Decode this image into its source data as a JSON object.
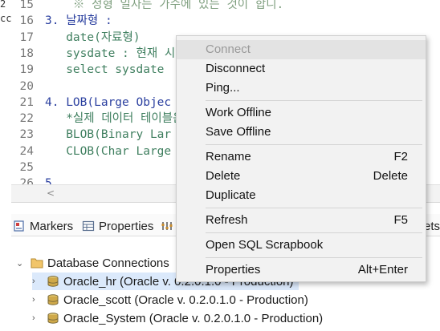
{
  "editor": {
    "edge_fragments": [
      "2",
      "cc"
    ],
    "lines": [
      {
        "num": "15",
        "text": "    ※ 정형 일자는 가수에 있는 것이 합니.",
        "style": "top"
      },
      {
        "num": "16",
        "text": "3. 날짜형 :",
        "style": "blue"
      },
      {
        "num": "17",
        "text": "   date(자료형)",
        "style": "normal"
      },
      {
        "num": "18",
        "text": "   sysdate : 현재 시",
        "style": "normal"
      },
      {
        "num": "19",
        "text": "   select sysdate",
        "style": "normal"
      },
      {
        "num": "20",
        "text": "",
        "style": "normal"
      },
      {
        "num": "21",
        "text": "4. LOB(Large Objec",
        "style": "blue"
      },
      {
        "num": "22",
        "text": "   *실제 데이터 테이블은",
        "style": "normal"
      },
      {
        "num": "23",
        "text": "   BLOB(Binary Lar",
        "style": "normal"
      },
      {
        "num": "24",
        "text": "   CLOB(Char Large",
        "style": "normal"
      },
      {
        "num": "25",
        "text": "",
        "style": "normal"
      },
      {
        "num": "26",
        "text": "5.              ",
        "style": "blue"
      }
    ],
    "scroll_arrow": "<"
  },
  "panel": {
    "tabs": [
      {
        "label": "Markers",
        "icon": "markers-icon"
      },
      {
        "label": "Properties",
        "icon": "properties-icon"
      },
      {
        "label": "",
        "icon": "servers-icon"
      },
      {
        "label": "ets",
        "icon": ""
      }
    ],
    "tree": {
      "root": {
        "label": "Database Connections",
        "icon": "folder-icon",
        "twisty": "⌄"
      },
      "children": [
        {
          "label": "Oracle_hr (Oracle v. 0.2.0.1.0 - Production)",
          "icon": "database-icon",
          "twisty": "›"
        },
        {
          "label": "Oracle_scott (Oracle v. 0.2.0.1.0 - Production)",
          "icon": "database-icon",
          "twisty": "›"
        },
        {
          "label": "Oracle_System (Oracle v. 0.2.0.1.0 - Production)",
          "icon": "database-icon",
          "twisty": "›"
        }
      ]
    }
  },
  "context_menu": {
    "items": [
      {
        "label": "Connect",
        "accelerator": "",
        "disabled": true
      },
      {
        "label": "Disconnect",
        "accelerator": "",
        "disabled": false
      },
      {
        "label": "Ping...",
        "accelerator": "",
        "disabled": false
      },
      {
        "separator": true
      },
      {
        "label": "Work Offline",
        "accelerator": "",
        "disabled": false
      },
      {
        "label": "Save Offline",
        "accelerator": "",
        "disabled": false
      },
      {
        "separator": true
      },
      {
        "label": "Rename",
        "accelerator": "F2",
        "disabled": false
      },
      {
        "label": "Delete",
        "accelerator": "Delete",
        "disabled": false
      },
      {
        "label": "Duplicate",
        "accelerator": "",
        "disabled": false
      },
      {
        "separator": true
      },
      {
        "label": "Refresh",
        "accelerator": "F5",
        "disabled": false
      },
      {
        "separator": true
      },
      {
        "label": "Open SQL Scrapbook",
        "accelerator": "",
        "disabled": false
      },
      {
        "separator": true
      },
      {
        "label": "Properties",
        "accelerator": "Alt+Enter",
        "disabled": false
      }
    ]
  },
  "colors": {
    "menu_bg": "#f2f2f2",
    "selection_bg": "#dbe9fb",
    "comment_green": "#3f7f5f",
    "heading_blue": "#2a3f9f"
  }
}
